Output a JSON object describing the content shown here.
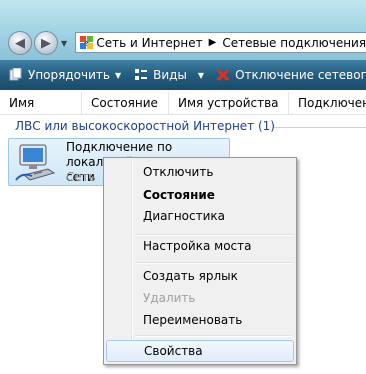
{
  "address": {
    "crumbs": [
      "«",
      "Сеть и Интернет",
      "Сетевые подключения"
    ],
    "separator": "▶"
  },
  "toolbar": {
    "organize": "Упорядочить",
    "views": "Виды",
    "disconnect": "Отключение сетевого"
  },
  "columns": [
    "Имя",
    "Состояние",
    "Имя устройства",
    "Подключение"
  ],
  "group": {
    "title": "ЛВС или высокоскоростной Интернет (1)"
  },
  "connection": {
    "name_line1": "Подключение по локальной",
    "name_line2": "сети",
    "status": "Сеть"
  },
  "menu": {
    "items": [
      {
        "label": "Отключить",
        "bold": false,
        "disabled": false
      },
      {
        "label": "Состояние",
        "bold": true,
        "disabled": false
      },
      {
        "label": "Диагностика",
        "bold": false,
        "disabled": false
      },
      {
        "label": "Настройка моста",
        "bold": false,
        "disabled": false
      },
      {
        "label": "Создать ярлык",
        "bold": false,
        "disabled": false
      },
      {
        "label": "Удалить",
        "bold": false,
        "disabled": true
      },
      {
        "label": "Переименовать",
        "bold": false,
        "disabled": false
      },
      {
        "label": "Свойства",
        "bold": false,
        "disabled": false,
        "highlighted": true
      }
    ]
  },
  "colors": {
    "toolbar": "#245d80",
    "group_title": "#1e3f8f",
    "selection": "#cfe6f6"
  }
}
